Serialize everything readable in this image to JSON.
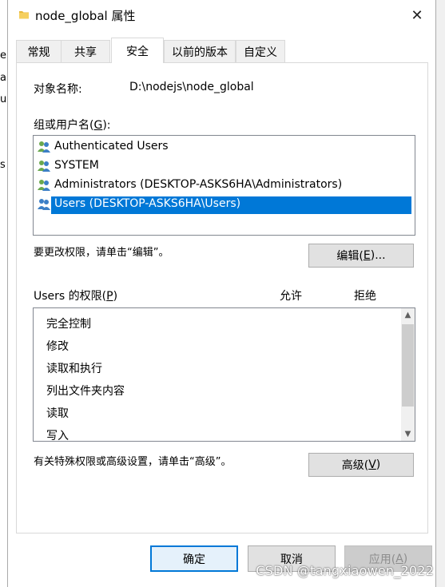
{
  "window": {
    "title": "node_global 属性",
    "close_glyph": "✕"
  },
  "background_fragments": [
    "e",
    "al",
    "ul",
    "s"
  ],
  "tabs": [
    {
      "label": "常规",
      "active": false
    },
    {
      "label": "共享",
      "active": false
    },
    {
      "label": "安全",
      "active": true
    },
    {
      "label": "以前的版本",
      "active": false
    },
    {
      "label": "自定义",
      "active": false
    }
  ],
  "security": {
    "object_name_label": "对象名称:",
    "object_name_value": "D:\\nodejs\\node_global",
    "group_label_prefix": "组或用户名(",
    "group_label_key": "G",
    "group_label_suffix": "):",
    "users": [
      {
        "name": "Authenticated Users",
        "selected": false
      },
      {
        "name": "SYSTEM",
        "selected": false
      },
      {
        "name": "Administrators (DESKTOP-ASKS6HA\\Administrators)",
        "selected": false
      },
      {
        "name": "Users (DESKTOP-ASKS6HA\\Users)",
        "selected": true
      }
    ],
    "edit_hint": "要更改权限，请单击“编辑”。",
    "edit_button_prefix": "编辑(",
    "edit_button_key": "E",
    "edit_button_suffix": ")...",
    "permissions_label_prefix": "Users 的权限(",
    "permissions_label_key": "P",
    "permissions_label_suffix": ")",
    "allow_header": "允许",
    "deny_header": "拒绝",
    "permissions": [
      "完全控制",
      "修改",
      "读取和执行",
      "列出文件夹内容",
      "读取",
      "写入"
    ],
    "advanced_hint": "有关特殊权限或高级设置，请单击“高级”。",
    "advanced_button_prefix": "高级(",
    "advanced_button_key": "V",
    "advanced_button_suffix": ")"
  },
  "footer": {
    "ok": "确定",
    "cancel": "取消",
    "apply_prefix": "应用(",
    "apply_key": "A",
    "apply_suffix": ")"
  },
  "watermark": "CSDN @tangxiaowen_2022",
  "colors": {
    "selection": "#0078d7",
    "folder": "#e8b83a",
    "user_icon_blue": "#3c7fc6",
    "user_icon_green": "#6aa84f"
  }
}
